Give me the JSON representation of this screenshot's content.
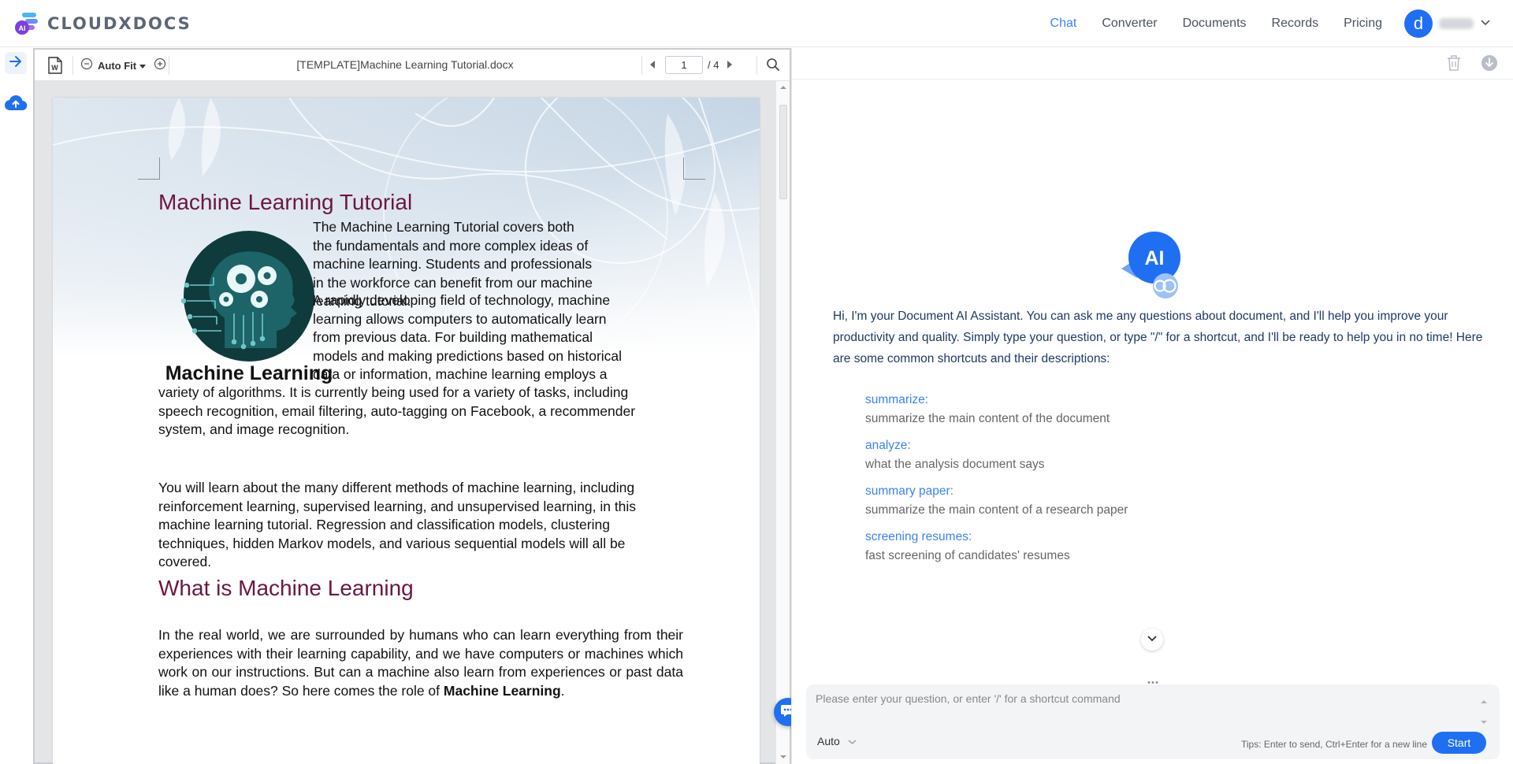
{
  "brand": {
    "name": "CLOUDXDOCS",
    "logo_badge": "AI"
  },
  "nav": {
    "items": [
      {
        "label": "Chat",
        "active": true
      },
      {
        "label": "Converter",
        "active": false
      },
      {
        "label": "Documents",
        "active": false
      },
      {
        "label": "Records",
        "active": false
      },
      {
        "label": "Pricing",
        "active": false
      }
    ],
    "avatar_letter": "d"
  },
  "rail": {
    "icons": [
      "arrow-right-icon",
      "cloud-upload-icon"
    ]
  },
  "viewer": {
    "zoom_label": "Auto Fit",
    "file_name": "[TEMPLATE]Machine Learning Tutorial.docx",
    "current_page": "1",
    "total_pages": "/ 4"
  },
  "document": {
    "title": "Machine Learning Tutorial",
    "figure_caption": "Machine Learning",
    "intro_1": "The Machine Learning Tutorial covers both the fundamentals and more complex ideas of machine learning. Students and professionals in the workforce can benefit from our machine learning tutorial.",
    "intro_2a_lines": [
      "A rapidly developing field of technology, machine",
      "learning allows computers to automatically learn",
      "from previous data. For building mathematical",
      "models and making predictions based on historical",
      "data or information, machine learning employs a"
    ],
    "intro_2b": "variety of algorithms. It is currently being used for a variety of tasks, including speech recognition, email filtering, auto-tagging on Facebook, a recommender system, and image recognition.",
    "paragraph_3": "You will learn about the many different methods of machine learning, including reinforcement learning, supervised learning, and unsupervised learning, in this machine learning tutorial. Regression and classification models, clustering techniques, hidden Markov models, and various sequential models will all be covered.",
    "heading_2": "What is Machine Learning",
    "paragraph_4": "In the real world, we are surrounded by humans who can learn everything from their experiences with their learning capability, and we have computers or machines which work on our instructions. But can a machine also learn from experiences or past data like a human does? So here comes the role of",
    "paragraph_4_bold": "Machine Learning",
    "paragraph_4_end": "."
  },
  "chat": {
    "badge": "AI",
    "greeting": "Hi, I'm your Document AI Assistant. You can ask me any questions about document, and I'll help you improve your productivity and quality. Simply type your question, or type \"/\" for a shortcut, and I'll be ready to help you in no time! Here are some common shortcuts and their descriptions:",
    "shortcuts": [
      {
        "name": "summarize:",
        "desc": "summarize the main content of the document"
      },
      {
        "name": "analyze:",
        "desc": "what the analysis document says"
      },
      {
        "name": "summary paper:",
        "desc": "summarize the main content of a research paper"
      },
      {
        "name": "screening resumes:",
        "desc": "fast screening of candidates' resumes"
      }
    ],
    "input_placeholder": "Please enter your question, or enter '/' for a shortcut command",
    "mode": "Auto",
    "tips": "Tips: Enter to send, Ctrl+Enter for a new line",
    "start_label": "Start"
  },
  "colors": {
    "accent": "#1f6ff2",
    "heading": "#6b1742",
    "nav_active": "#3b82f6",
    "greeting": "#1d3a66"
  }
}
